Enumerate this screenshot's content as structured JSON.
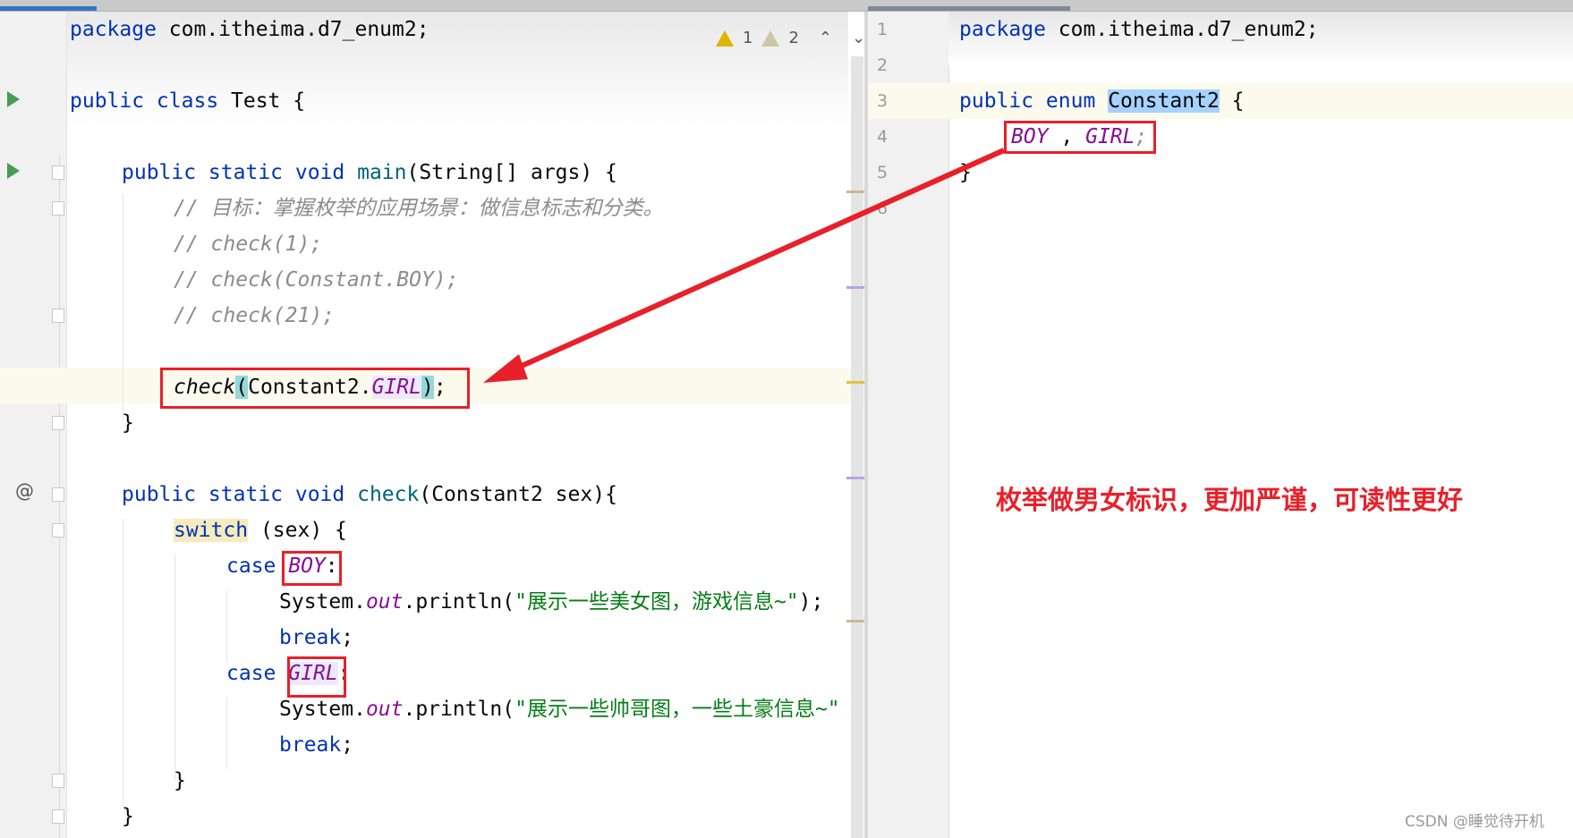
{
  "left_editor": {
    "inspections": {
      "warnings": "1",
      "weak_warnings": "2"
    },
    "lines": {
      "l1": {
        "kw": "package",
        "rest": " com.itheima.d7_enum2;"
      },
      "l3": {
        "kw": "public class",
        "rest": " Test {"
      },
      "l5": {
        "kw": "public static void",
        "fn": "main",
        "rest": "(String[] args) {"
      },
      "l6": "// 目标：掌握枚举的应用场景：做信息标志和分类。",
      "l7": "// check(1);",
      "l8": "// check(Constant.BOY);",
      "l9": "// check(21);",
      "l11": {
        "call": "check",
        "open": "(",
        "cls": "Constant2.",
        "enum": "GIRL",
        "close": ")",
        "end": ";"
      },
      "l12": "}",
      "l14": {
        "kw": "public static void",
        "fn": "check",
        "rest": "(Constant2 sex){"
      },
      "l15": {
        "kw": "switch",
        "rest": " (sex) {"
      },
      "l16": {
        "kw": "case",
        "enum": "BOY",
        "end": ":"
      },
      "l17": {
        "pre": "System.",
        "field": "out",
        "post": ".println(",
        "str": "\"展示一些美女图，游戏信息~\"",
        "end": ");"
      },
      "l18": {
        "kw": "break",
        "end": ";"
      },
      "l19": {
        "kw": "case",
        "enum": "GIRL",
        "end": ":"
      },
      "l20": {
        "pre": "System.",
        "field": "out",
        "post": ".println(",
        "str": "\"展示一些帅哥图，一些土豪信息~\""
      },
      "l21": {
        "kw": "break",
        "end": ";"
      },
      "l22": "}",
      "l23": "}"
    }
  },
  "right_editor": {
    "line_numbers": [
      "1",
      "2",
      "3",
      "4",
      "5",
      "6"
    ],
    "lines": {
      "l1": {
        "kw": "package",
        "rest": " com.itheima.d7_enum2;"
      },
      "l3": {
        "kw": "public enum",
        "name": "Constant2",
        "rest": " {"
      },
      "l4": {
        "boy": "BOY",
        "sep": " , ",
        "girl": "GIRL",
        "end": ";"
      },
      "l5": "}"
    }
  },
  "annotation": "枚举做男女标识，更加严谨，可读性更好",
  "watermark": "CSDN @睡觉待开机",
  "colors": {
    "annotation_red": "#e8202a",
    "keyword": "#0033b3",
    "enum_constant": "#871094",
    "string": "#067d17",
    "comment": "#8c8c8c"
  }
}
